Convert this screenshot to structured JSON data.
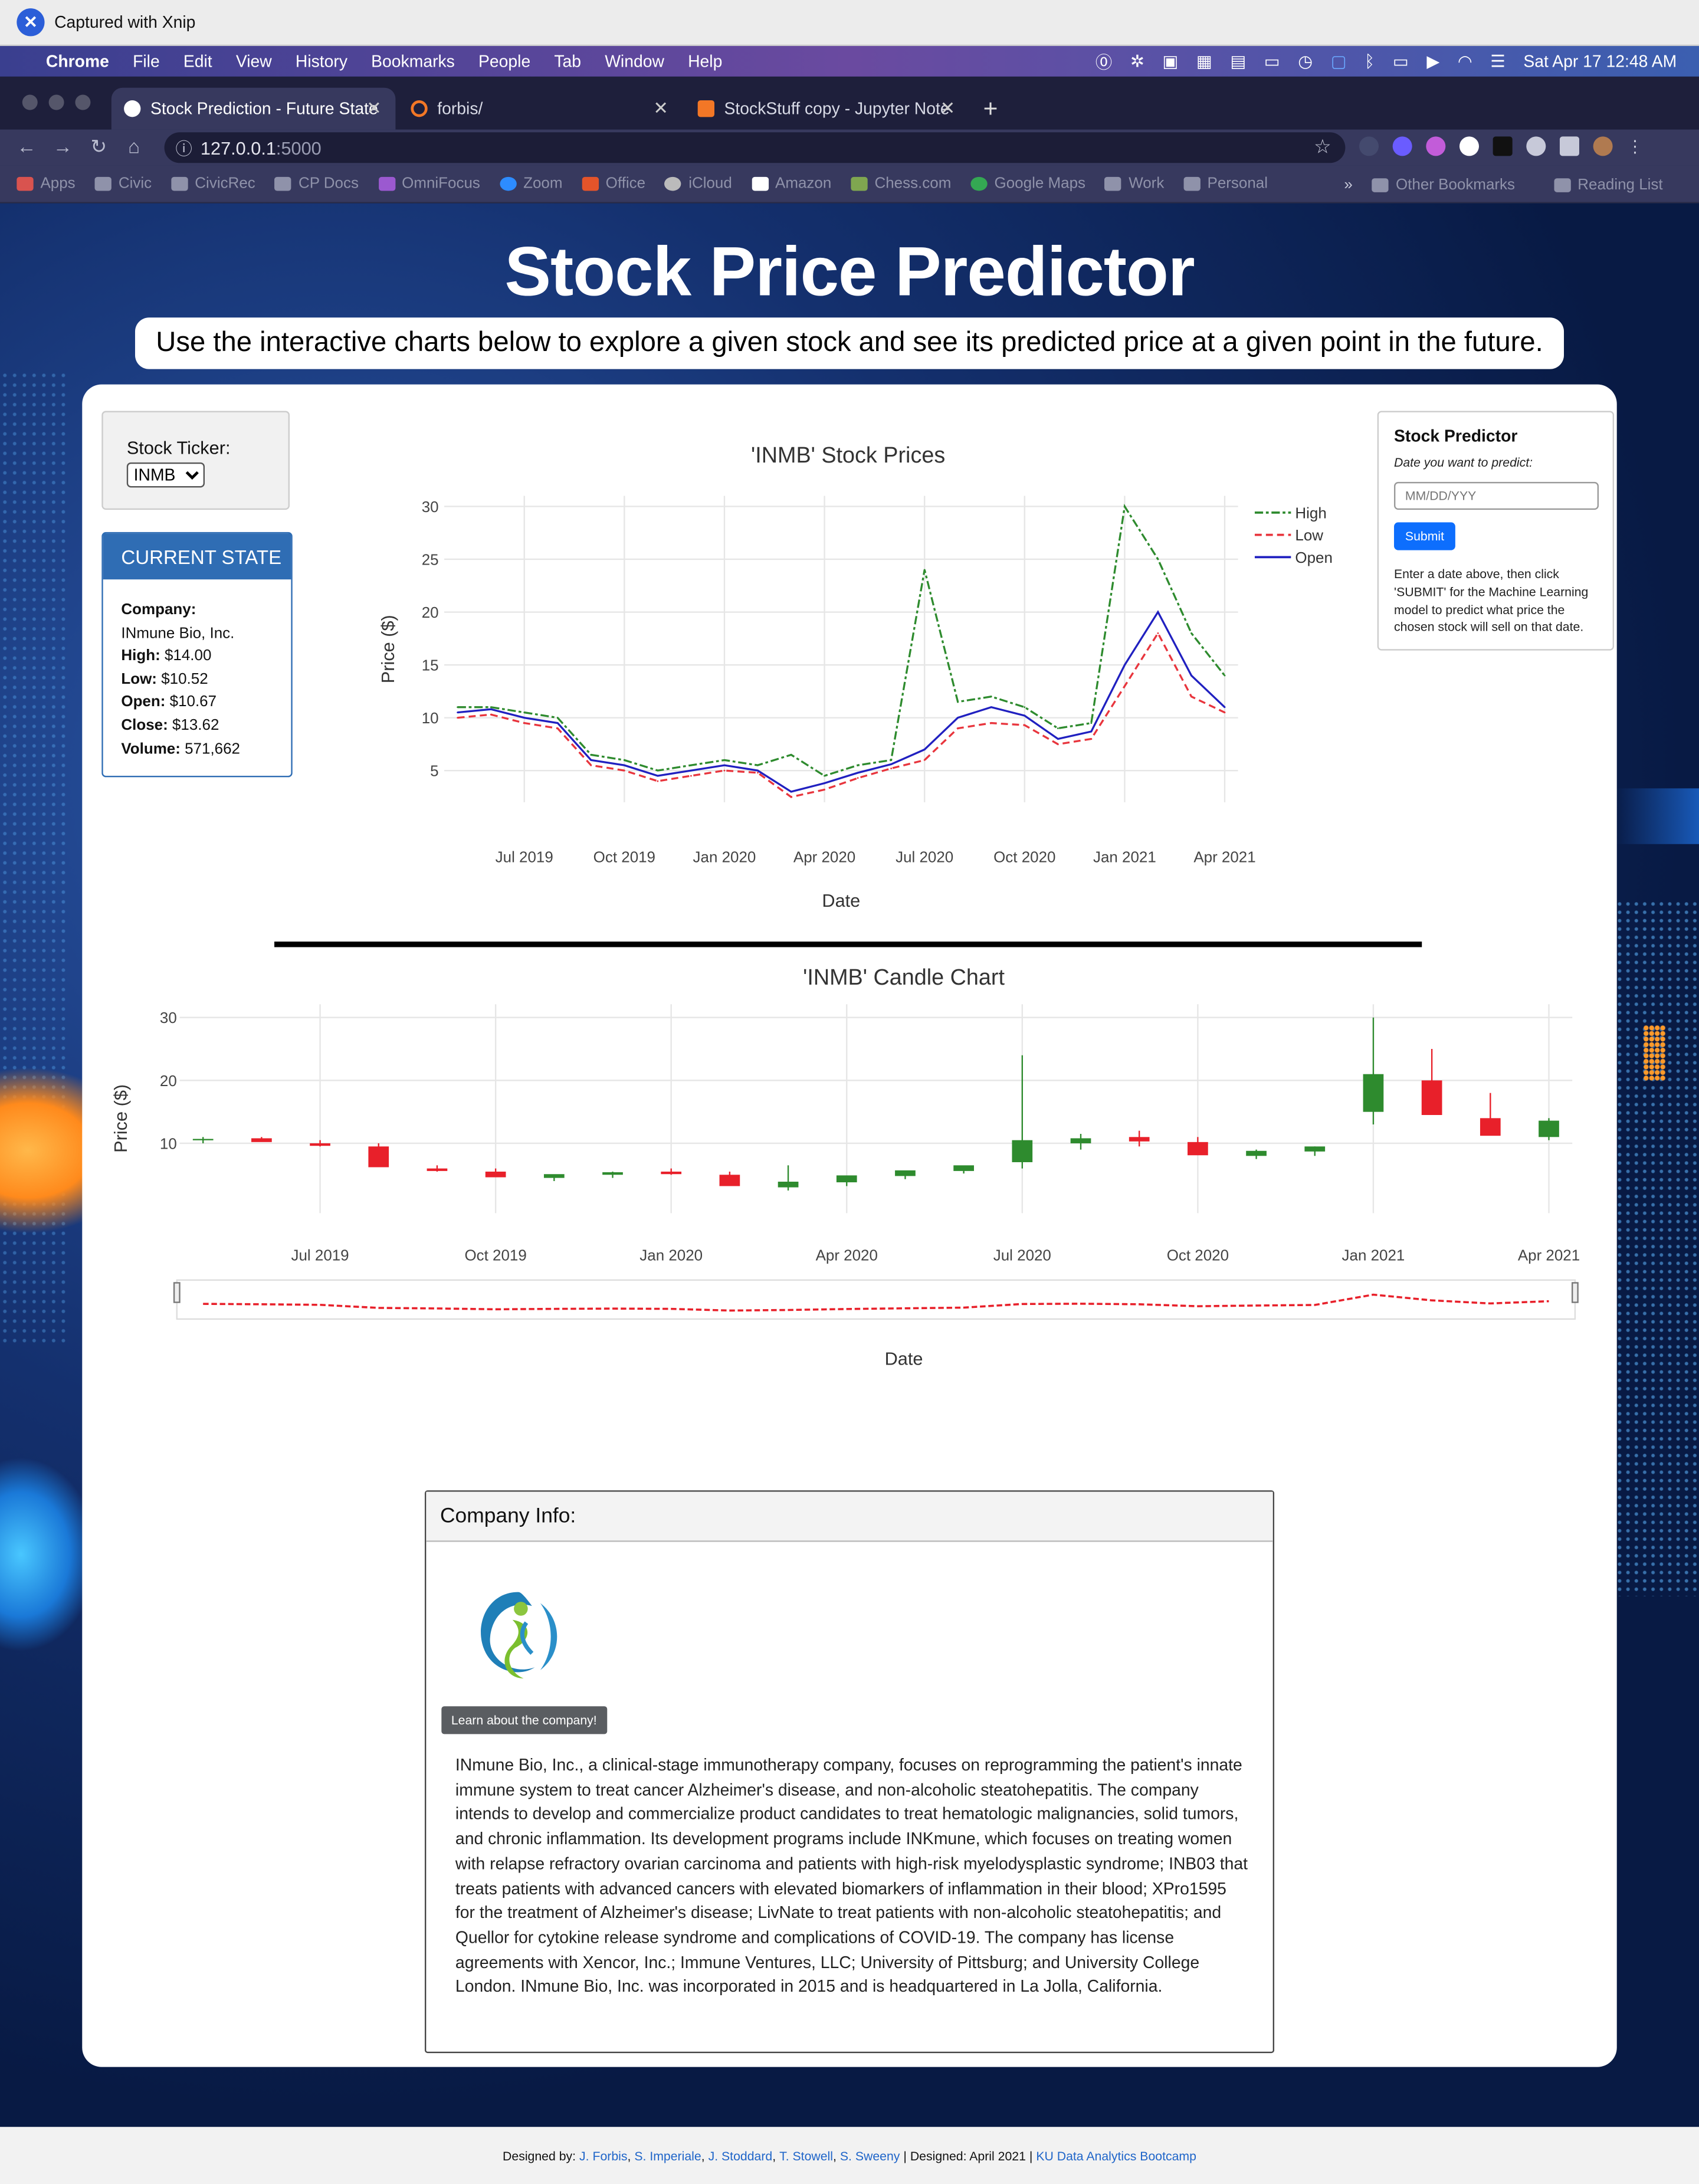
{
  "xnip": {
    "caption": "Captured with Xnip"
  },
  "menubar": {
    "items": [
      "Chrome",
      "File",
      "Edit",
      "View",
      "History",
      "Bookmarks",
      "People",
      "Tab",
      "Window",
      "Help"
    ],
    "clock": "Sat Apr 17  12:48 AM"
  },
  "tabs": [
    {
      "title": "Stock Prediction - Future State"
    },
    {
      "title": "forbis/"
    },
    {
      "title": "StockStuff copy - Jupyter Note"
    }
  ],
  "address": {
    "host": "127.0.0.1",
    "port": ":5000"
  },
  "bookmarks": [
    "Apps",
    "Civic",
    "CivicRec",
    "CP Docs",
    "OmniFocus",
    "Zoom",
    "Office",
    "iCloud",
    "Amazon",
    "Chess.com",
    "Google Maps",
    "Work",
    "Personal"
  ],
  "bookmarks_right": [
    "»",
    "Other Bookmarks",
    "Reading List"
  ],
  "page": {
    "title": "Stock Price Predictor",
    "subtitle": "Use the interactive charts below to explore a given stock and see its predicted price at a given point in the future."
  },
  "ticker": {
    "label": "Stock Ticker:",
    "selected": "INMB"
  },
  "current_state": {
    "heading": "CURRENT STATE",
    "company_label": "Company:",
    "company": "INmune Bio, Inc.",
    "high_label": "High:",
    "high": "$14.00",
    "low_label": "Low:",
    "low": "$10.52",
    "open_label": "Open:",
    "open": "$10.67",
    "close_label": "Close:",
    "close": "$13.62",
    "volume_label": "Volume:",
    "volume": "571,662"
  },
  "predictor": {
    "heading": "Stock Predictor",
    "subheading": "Date you want to predict:",
    "placeholder": "MM/DD/YYY",
    "submit": "Submit",
    "description": "Enter a date above, then click 'SUBMIT' for the Machine Learning model to predict what price the chosen stock will sell on that date."
  },
  "chart_data": [
    {
      "type": "line",
      "title": "'INMB' Stock Prices",
      "xlabel": "Date",
      "ylabel": "Price ($)",
      "ylim": [
        2,
        31
      ],
      "x_ticks": [
        "Jul 2019",
        "Oct 2019",
        "Jan 2020",
        "Apr 2020",
        "Jul 2020",
        "Oct 2020",
        "Jan 2021",
        "Apr 2021"
      ],
      "y_ticks": [
        5,
        10,
        15,
        20,
        25,
        30
      ],
      "legend": "top-right",
      "grid": true,
      "x": [
        "2019-05",
        "2019-06",
        "2019-07",
        "2019-08",
        "2019-09",
        "2019-10",
        "2019-11",
        "2019-12",
        "2020-01",
        "2020-02",
        "2020-03",
        "2020-04",
        "2020-05",
        "2020-06",
        "2020-07",
        "2020-08",
        "2020-09",
        "2020-10",
        "2020-11",
        "2020-12",
        "2021-01",
        "2021-02",
        "2021-03",
        "2021-04"
      ],
      "series": [
        {
          "name": "High",
          "color": "#2e8b2e",
          "dash": "dashdot",
          "values": [
            11,
            11,
            10.5,
            10,
            6.5,
            6,
            5,
            5.5,
            6,
            5.5,
            6.5,
            4.5,
            5.5,
            6,
            24,
            11.5,
            12,
            11,
            9,
            9.5,
            30,
            25,
            18,
            14
          ]
        },
        {
          "name": "Low",
          "color": "#e8353d",
          "dash": "dash",
          "values": [
            10,
            10.3,
            9.5,
            9,
            5.5,
            5,
            4,
            4.5,
            5,
            4.8,
            2.5,
            3.2,
            4.3,
            5.2,
            6,
            9,
            9.5,
            9.3,
            7.5,
            8,
            13,
            18,
            12,
            10.5
          ]
        },
        {
          "name": "Open",
          "color": "#2020c0",
          "dash": "solid",
          "values": [
            10.5,
            10.8,
            10,
            9.5,
            6,
            5.5,
            4.5,
            5,
            5.5,
            5,
            3,
            3.8,
            4.8,
            5.6,
            7,
            10,
            11,
            10.2,
            8,
            8.7,
            15,
            20,
            14,
            11
          ]
        }
      ]
    },
    {
      "type": "candlestick",
      "title": "'INMB' Candle Chart",
      "xlabel": "Date",
      "ylabel": "Price ($)",
      "ylim": [
        0,
        31
      ],
      "x_ticks": [
        "Jul 2019",
        "Oct 2019",
        "Jan 2020",
        "Apr 2020",
        "Jul 2020",
        "Oct 2020",
        "Jan 2021",
        "Apr 2021"
      ],
      "y_ticks": [
        10,
        20,
        30
      ],
      "grid": true,
      "increasing_color": "#2e8b2e",
      "decreasing_color": "#e8202a",
      "x": [
        "2019-05",
        "2019-06",
        "2019-07",
        "2019-08",
        "2019-09",
        "2019-10",
        "2019-11",
        "2019-12",
        "2020-01",
        "2020-02",
        "2020-03",
        "2020-04",
        "2020-05",
        "2020-06",
        "2020-07",
        "2020-08",
        "2020-09",
        "2020-10",
        "2020-11",
        "2020-12",
        "2021-01",
        "2021-02",
        "2021-03",
        "2021-04"
      ],
      "open": [
        10.5,
        10.8,
        10,
        9.5,
        6,
        5.5,
        4.5,
        5,
        5.5,
        5,
        3,
        3.8,
        4.8,
        5.6,
        7,
        10,
        11,
        10.2,
        8,
        8.7,
        15,
        20,
        14,
        11
      ],
      "high": [
        11,
        11,
        10.5,
        10,
        6.5,
        6,
        5,
        5.5,
        6,
        5.5,
        6.5,
        4.5,
        5.5,
        6,
        24,
        11.5,
        12,
        11,
        9,
        9.5,
        30,
        25,
        18,
        14
      ],
      "low": [
        10,
        10.3,
        9.5,
        9,
        5.5,
        5,
        4,
        4.5,
        5,
        4.8,
        2.5,
        3.2,
        4.3,
        5.2,
        6,
        9,
        9.5,
        9.3,
        7.5,
        8,
        13,
        18,
        12,
        10.5
      ],
      "close": [
        10.7,
        10.2,
        9.6,
        6.2,
        5.6,
        4.6,
        5.1,
        5.4,
        5.1,
        3.2,
        3.9,
        4.9,
        5.7,
        6.5,
        10.5,
        10.8,
        10.3,
        8.1,
        8.8,
        9.5,
        21,
        14.5,
        11.2,
        13.6
      ]
    }
  ],
  "company_info": {
    "heading": "Company Info:",
    "button": "Learn about the company!",
    "description": "INmune Bio, Inc., a clinical-stage immunotherapy company, focuses on reprogramming the patient's innate immune system to treat cancer Alzheimer's disease, and non-alcoholic steatohepatitis. The company intends to develop and commercialize product candidates to treat hematologic malignancies, solid tumors, and chronic inflammation. Its development programs include INKmune, which focuses on treating women with relapse refractory ovarian carcinoma and patients with high-risk myelodysplastic syndrome; INB03 that treats patients with advanced cancers with elevated biomarkers of inflammation in their blood; XPro1595 for the treatment of Alzheimer's disease; LivNate to treat patients with non-alcoholic steatohepatitis; and Quellor for cytokine release syndrome and complications of COVID-19. The company has license agreements with Xencor, Inc.; Immune Ventures, LLC; University of Pittsburg; and University College London. INmune Bio, Inc. was incorporated in 2015 and is headquartered in La Jolla, California."
  },
  "footer": {
    "designed_by_label": "Designed by:",
    "designers": [
      "J. Forbis",
      "S. Imperiale",
      "J. Stoddard",
      "T. Stowell",
      "S. Sweeny"
    ],
    "separator": "|",
    "designed_date": "Designed: April 2021",
    "bootcamp": "KU Data Analytics Bootcamp"
  }
}
